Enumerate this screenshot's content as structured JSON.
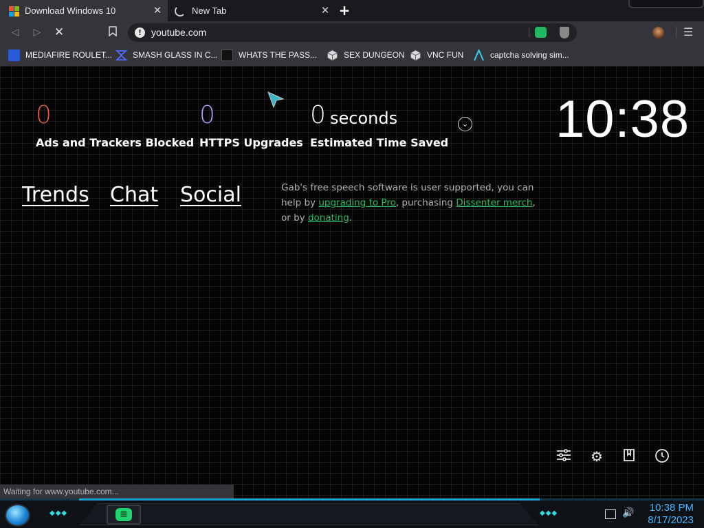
{
  "tabs": [
    {
      "label": "Download Windows 10",
      "active": true
    },
    {
      "label": "New Tab",
      "active": false
    }
  ],
  "new_tab_glyph": "+",
  "toolbar": {
    "url": "youtube.com"
  },
  "bookmarks": [
    {
      "label": "MEDIAFIRE ROULET...",
      "icon": "mediafire-icon"
    },
    {
      "label": "SMASH GLASS IN C...",
      "icon": "smash-glass-icon"
    },
    {
      "label": "WHATS THE PASS...",
      "icon": "lock-icon"
    },
    {
      "label": "SEX DUNGEON",
      "icon": "cube-icon"
    },
    {
      "label": "VNC FUN",
      "icon": "cube-icon"
    },
    {
      "label": "captcha solving sim...",
      "icon": "letter-a-icon"
    }
  ],
  "stats": {
    "ads_blocked": {
      "value": "0",
      "label": "Ads and Trackers Blocked"
    },
    "https_upgrades": {
      "value": "0",
      "label": "HTTPS Upgrades"
    },
    "time_saved": {
      "value": "0",
      "unit": "seconds",
      "label": "Estimated Time Saved"
    }
  },
  "clock": "10:38",
  "links": {
    "trends": "Trends",
    "chat": "Chat",
    "social": "Social"
  },
  "gab_message": {
    "part1": "Gab's free speech software is user supported, you can help by ",
    "link1": "upgrading to Pro",
    "part2": ", purchasing ",
    "link2": "Dissenter merch",
    "part3": ", or by ",
    "link3": "donating",
    "part4": "."
  },
  "bottom_icons": [
    "sliders-icon",
    "gear-icon",
    "bookmarks-icon",
    "history-icon"
  ],
  "status_text": "Waiting for www.youtube.com...",
  "taskbar": {
    "time": "10:38 PM",
    "date": "8/17/2023"
  },
  "colors": {
    "ads_accent": "#f05a3c",
    "https_accent": "#a3a0ff",
    "link_green": "#2cba5a",
    "tray_time": "#3fb6ff"
  }
}
